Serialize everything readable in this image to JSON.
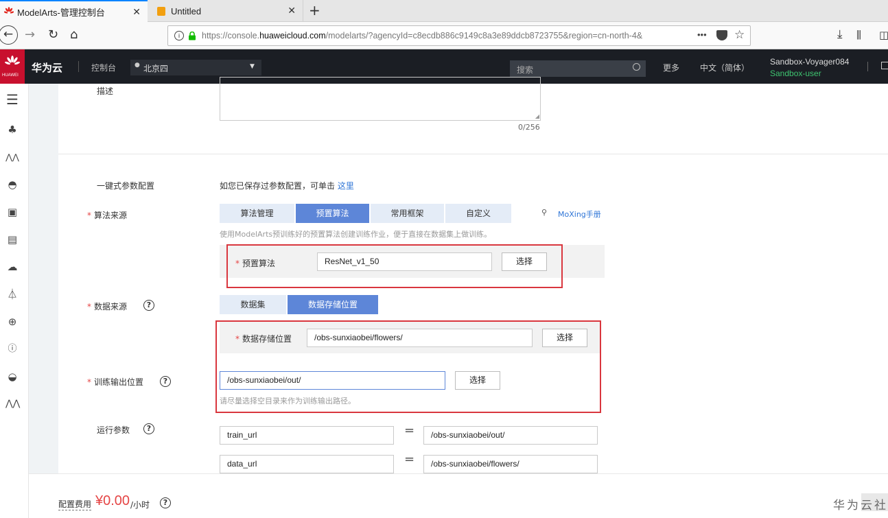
{
  "browser": {
    "tabs": [
      {
        "title": "ModelArts-管理控制台"
      },
      {
        "title": "Untitled"
      }
    ],
    "url": {
      "prefix": "https://console.",
      "domain": "huaweicloud.com",
      "path": "/modelarts/?agencyId=c8ecdb886c9149c8a3e89ddcb8723755&region=cn-north-4&"
    },
    "overflow_label": "•••"
  },
  "header": {
    "logo_text": "HUAWEI",
    "brand": "华为云",
    "console": "控制台",
    "region": "北京四",
    "search_placeholder": "搜索",
    "more": "更多",
    "language": "中文（简体）",
    "account_name": "Sandbox-Voyager084",
    "account_user": "Sandbox-user"
  },
  "form": {
    "description_label": "描述",
    "description_counter": "0/256",
    "one_click_label": "一键式参数配置",
    "one_click_text": "如您已保存过参数配置，可单击",
    "one_click_link": "这里",
    "algo_source_label": "算法来源",
    "algo_tabs": [
      "算法管理",
      "预置算法",
      "常用框架",
      "自定义"
    ],
    "moxing_link": "MoXing手册",
    "algo_hint": "使用ModelArts预训练好的预置算法创建训练作业，便于直接在数据集上做训练。",
    "preset_algo_label": "预置算法",
    "preset_algo_value": "ResNet_v1_50",
    "select_label": "选择",
    "data_source_label": "数据来源",
    "data_tabs": [
      "数据集",
      "数据存储位置"
    ],
    "data_storage_label": "数据存储位置",
    "data_storage_value": "/obs-sunxiaobei/flowers/",
    "output_label": "训练输出位置",
    "output_value": "/obs-sunxiaobei/out/",
    "output_hint": "请尽量选择空目录来作为训练输出路径。",
    "run_params_label": "运行参数",
    "params": [
      {
        "key": "train_url",
        "value": "/obs-sunxiaobei/out/"
      },
      {
        "key": "data_url",
        "value": "/obs-sunxiaobei/flowers/"
      }
    ]
  },
  "footer": {
    "cost_label": "配置费用",
    "cost_value": "¥0.00",
    "cost_unit": "/小时",
    "watermark": "华为云社区"
  },
  "colors": {
    "accent": "#5d86d8",
    "header_bg": "#1b1e24",
    "price": "#e54545",
    "annotation": "#d9363e"
  }
}
